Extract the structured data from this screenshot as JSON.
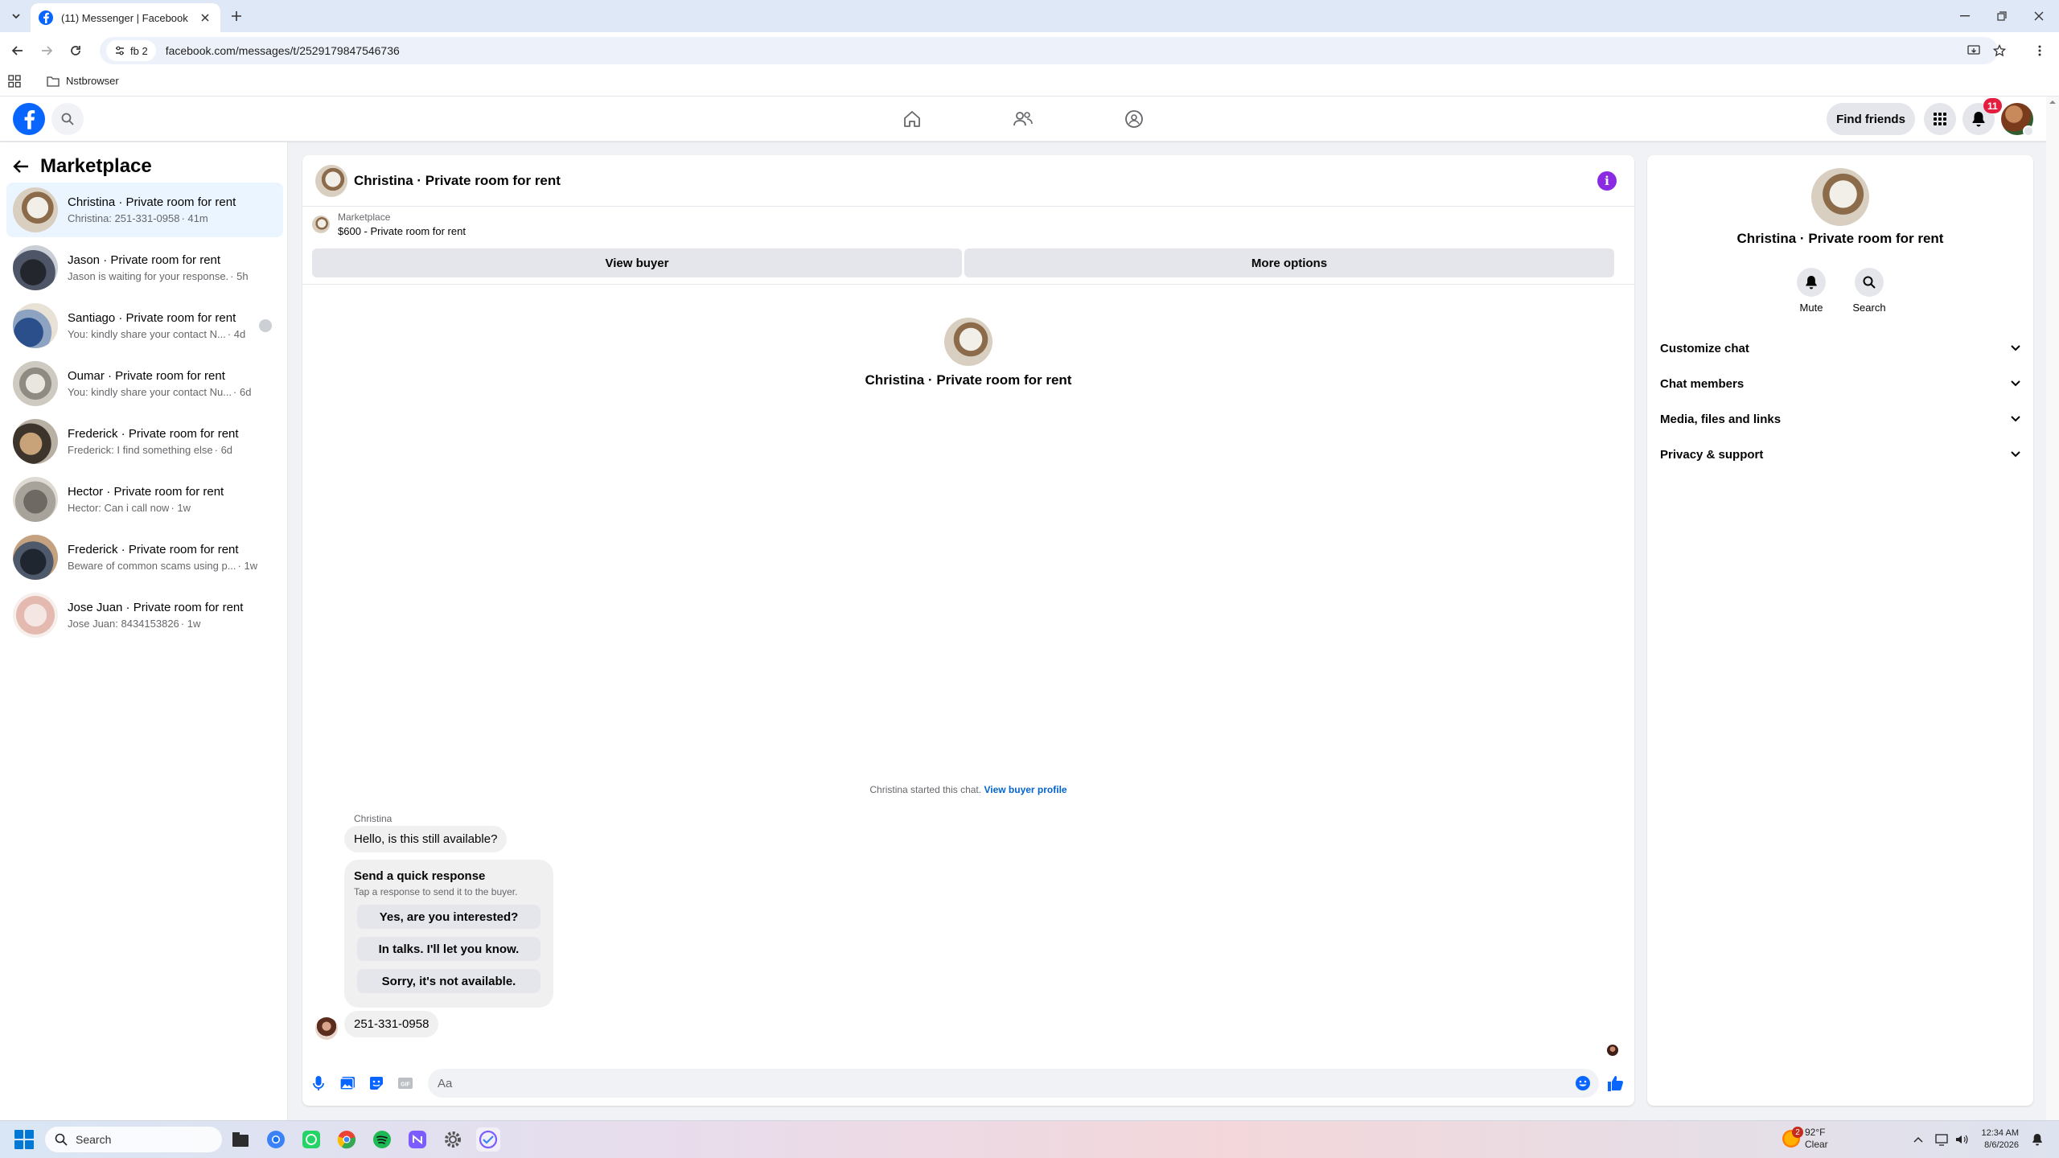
{
  "browser": {
    "tab_title": "(11) Messenger | Facebook",
    "profile_chip": "fb 2",
    "url": "facebook.com/messages/t/2529179847546736",
    "bookmark_folder": "Nstbrowser"
  },
  "header": {
    "find_friends": "Find friends",
    "notification_count": "11"
  },
  "sidebar": {
    "title": "Marketplace",
    "conversations": [
      {
        "name": "Christina · Private room for rent",
        "preview": "Christina: 251-331-0958",
        "time": "· 41m",
        "active": true
      },
      {
        "name": "Jason · Private room for rent",
        "preview": "Jason is waiting for your response.",
        "time": "· 5h"
      },
      {
        "name": "Santiago · Private room for rent",
        "preview": "You: kindly share your contact N...",
        "time": "· 4d"
      },
      {
        "name": "Oumar · Private room for rent",
        "preview": "You: kindly share your contact Nu...",
        "time": "· 6d"
      },
      {
        "name": "Frederick · Private room for rent",
        "preview": "Frederick: I find something else",
        "time": "· 6d"
      },
      {
        "name": "Hector · Private room for rent",
        "preview": "Hector: Can i call now",
        "time": "· 1w"
      },
      {
        "name": "Frederick · Private room for rent",
        "preview": "Beware of common scams using p...",
        "time": "· 1w"
      },
      {
        "name": "Jose Juan · Private room for rent",
        "preview": "Jose Juan: 8434153826",
        "time": "· 1w"
      }
    ]
  },
  "chat": {
    "title": "Christina · Private room for rent",
    "listing_source": "Marketplace",
    "listing_title": "$600 - Private room for rent",
    "view_buyer": "View buyer",
    "more_options": "More options",
    "intro_title": "Christina · Private room for rent",
    "system_note": "Christina started this chat.",
    "system_link": "View buyer profile",
    "sender_name": "Christina",
    "message_1": "Hello, is this still available?",
    "quick_title": "Send a quick response",
    "quick_subtitle": "Tap a response to send it to the buyer.",
    "quick_replies": [
      "Yes, are you interested?",
      "In talks. I'll let you know.",
      "Sorry, it's not available."
    ],
    "message_2": "251-331-0958",
    "composer_placeholder": "Aa"
  },
  "right_panel": {
    "title": "Christina · Private room for rent",
    "mute": "Mute",
    "search": "Search",
    "sections": [
      "Customize chat",
      "Chat members",
      "Media, files and links",
      "Privacy & support"
    ]
  },
  "taskbar": {
    "search": "Search",
    "weather_badge": "2",
    "temperature": "92°F",
    "condition": "Clear",
    "time": "12:34 AM",
    "date": "8/6/2026"
  }
}
